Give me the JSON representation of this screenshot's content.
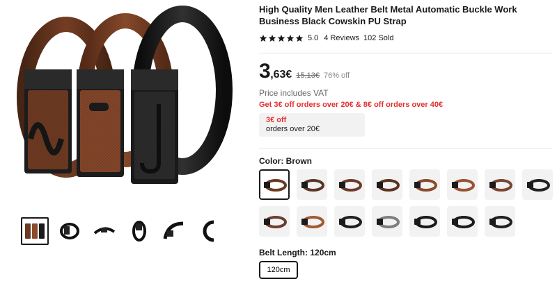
{
  "product": {
    "title": "High Quality Men Leather Belt Metal Automatic Buckle Work Business Black Cowskin PU Strap",
    "rating": {
      "score": "5.0",
      "stars": 5,
      "reviews": "4 Reviews",
      "sold": "102 Sold"
    }
  },
  "price": {
    "integer": "3",
    "decimal": ",63€",
    "original": "15,13€",
    "discount": "76% off",
    "vat_note": "Price includes VAT",
    "promo": "Get 3€ off orders over 20€ & 8€ off orders over 40€",
    "coupon_amount": "3€ off",
    "coupon_condition": "orders over 20€"
  },
  "gallery": {
    "thumbnails": [
      {
        "icon": "three-belts-image",
        "active": true
      },
      {
        "icon": "black-belt-coiled-image",
        "active": false
      },
      {
        "icon": "black-belt-flat-image",
        "active": false
      },
      {
        "icon": "black-belt-roll-image",
        "active": false
      },
      {
        "icon": "black-belt-curve-image",
        "active": false
      },
      {
        "icon": "black-belt-loop-image",
        "active": false
      }
    ]
  },
  "color": {
    "label": "Color:",
    "value": "Brown",
    "swatches": [
      {
        "tone": "#6b3a23",
        "selected": true
      },
      {
        "tone": "#5a3627",
        "selected": false
      },
      {
        "tone": "#6a3a2b",
        "selected": false
      },
      {
        "tone": "#5c3420",
        "selected": false
      },
      {
        "tone": "#8a4a2c",
        "selected": false
      },
      {
        "tone": "#9a5231",
        "selected": false
      },
      {
        "tone": "#7a4530",
        "selected": false
      },
      {
        "tone": "#222222",
        "selected": false
      },
      {
        "tone": "#6d3d30",
        "selected": false
      },
      {
        "tone": "#a05a34",
        "selected": false
      },
      {
        "tone": "#1f1f1f",
        "selected": false
      },
      {
        "tone": "#7e7e7e",
        "selected": false
      },
      {
        "tone": "#1a1a1a",
        "selected": false
      },
      {
        "tone": "#1c1c1c",
        "selected": false
      },
      {
        "tone": "#202020",
        "selected": false
      }
    ]
  },
  "length": {
    "label": "Belt Length:",
    "value": "120cm",
    "options": [
      "120cm"
    ]
  },
  "colors": {
    "accent": "#e62e2e",
    "text": "#191919",
    "muted": "#666666",
    "star": "#191919"
  }
}
